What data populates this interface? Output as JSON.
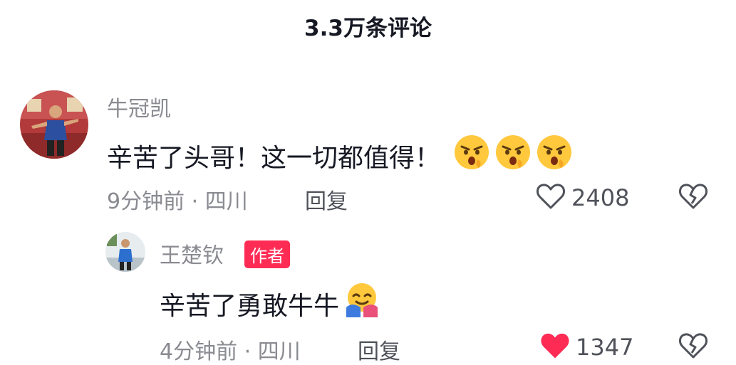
{
  "header": {
    "title": "3.3万条评论"
  },
  "comments": [
    {
      "author": "牛冠凯",
      "text": "辛苦了头哥！这一切都值得！",
      "emojis": [
        "angry-face-emoji",
        "angry-face-emoji",
        "angry-face-emoji"
      ],
      "time": "9分钟前",
      "location": "四川",
      "meta": "9分钟前 · 四川",
      "reply_label": "回复",
      "likes": "2408",
      "liked": false
    }
  ],
  "replies": [
    {
      "author": "王楚钦",
      "badge": "作者",
      "text": "辛苦了勇敢牛牛",
      "emojis": [
        "hugging-face-emoji"
      ],
      "time": "4分钟前",
      "location": "四川",
      "meta": "4分钟前 · 四川",
      "reply_label": "回复",
      "likes": "1347",
      "liked": true
    }
  ],
  "colors": {
    "accent": "#fe2c55",
    "text_primary": "#161823",
    "text_secondary": "#8a8b91",
    "emoji_yellow": "#ffc83d"
  }
}
